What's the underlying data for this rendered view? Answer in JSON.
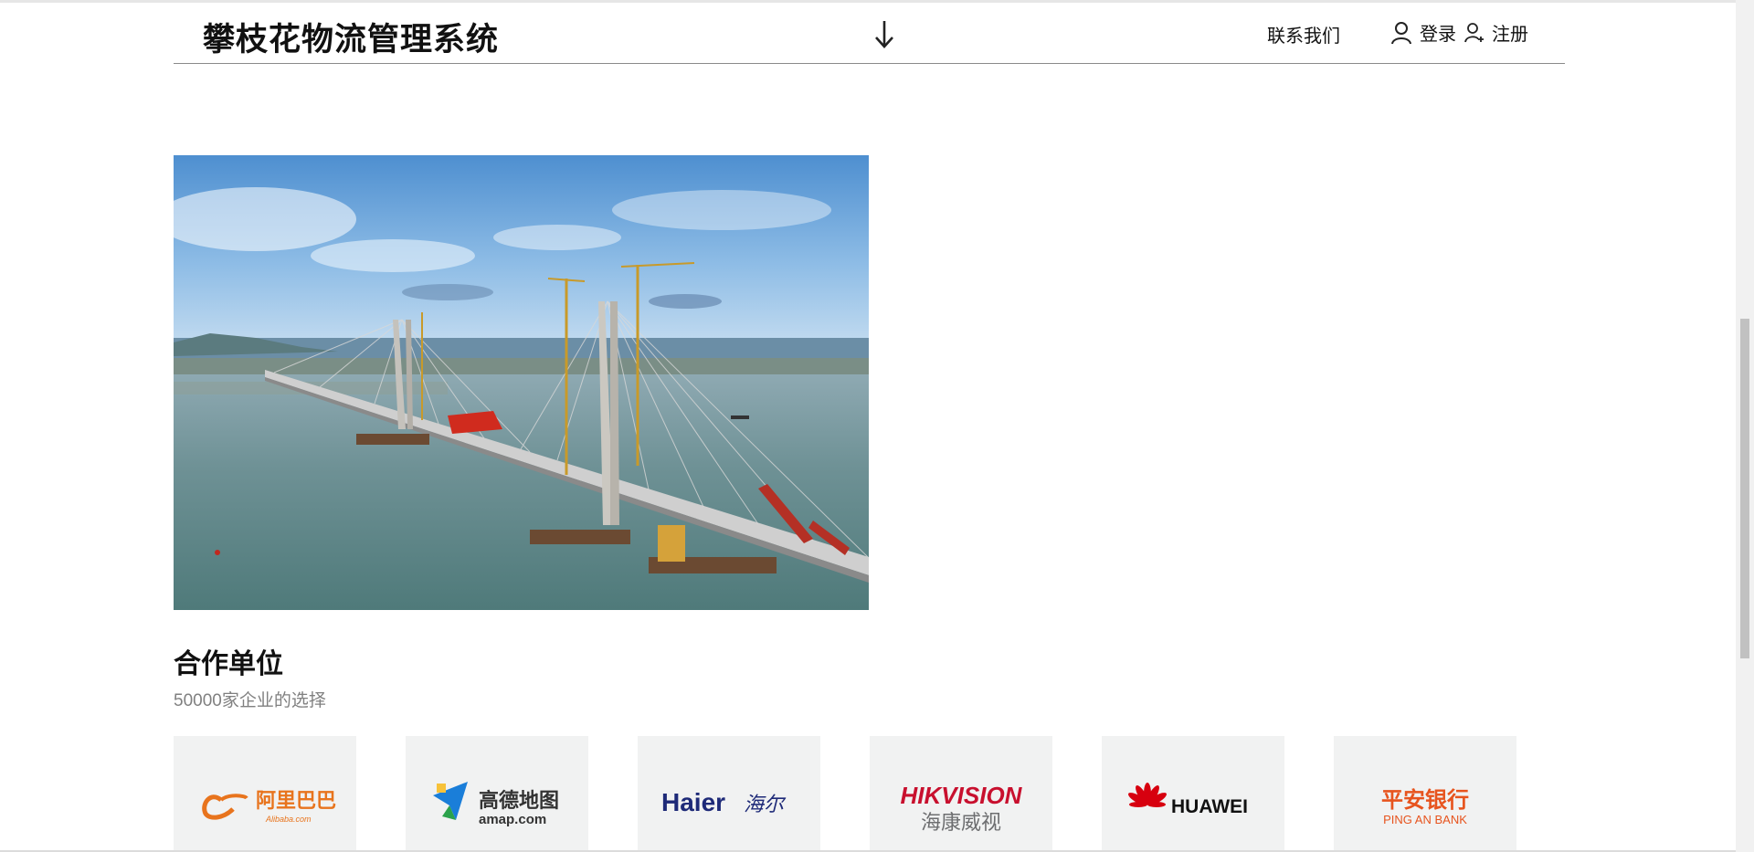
{
  "header": {
    "brand": "攀枝花物流管理系统",
    "nav": {
      "contact": "联系我们",
      "login": "登录",
      "register": "注册"
    }
  },
  "hero": {
    "icon": "bridge-photo"
  },
  "partners": {
    "title": "合作单位",
    "subtitle": "50000家企业的选择",
    "logos": [
      {
        "name": "alibaba",
        "cn": "阿里巴巴",
        "en": "Alibaba.com"
      },
      {
        "name": "amap",
        "cn": "高德地图",
        "en": "amap.com"
      },
      {
        "name": "haier",
        "en": "Haier",
        "cn": "海尔"
      },
      {
        "name": "hikvision",
        "en": "HIKVISION",
        "cn": "海康威视"
      },
      {
        "name": "huawei",
        "en": "HUAWEI"
      },
      {
        "name": "pingan",
        "cn": "平安银行",
        "en": "PING AN BANK"
      }
    ]
  },
  "colors": {
    "alibaba": "#e8741d",
    "amap_blue": "#1a7ed9",
    "haier_blue": "#1e2a78",
    "hikvision_red": "#c8102e",
    "hikvision_gray": "#6d6e70",
    "huawei_red": "#d7000f",
    "pingan_orange": "#e7541e"
  }
}
